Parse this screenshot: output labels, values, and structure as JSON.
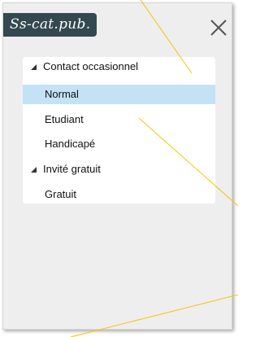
{
  "dialog": {
    "title": "Ss-cat.pub.",
    "close_icon": "close-x-icon"
  },
  "list": {
    "items": [
      {
        "label": "Contact occasionnel",
        "type": "group",
        "expanded": true
      },
      {
        "label": "Normal",
        "type": "child",
        "selected": true
      },
      {
        "label": "Etudiant",
        "type": "child"
      },
      {
        "label": "Handicapé",
        "type": "child"
      },
      {
        "label": "Invité gratuit",
        "type": "group",
        "expanded": true
      },
      {
        "label": "Gratuit",
        "type": "child"
      }
    ]
  },
  "colors": {
    "title_bg": "#34494f",
    "selection": "#c4e2f6",
    "panel_bg": "#eeeeee",
    "annotation_line": "#f5c400"
  }
}
